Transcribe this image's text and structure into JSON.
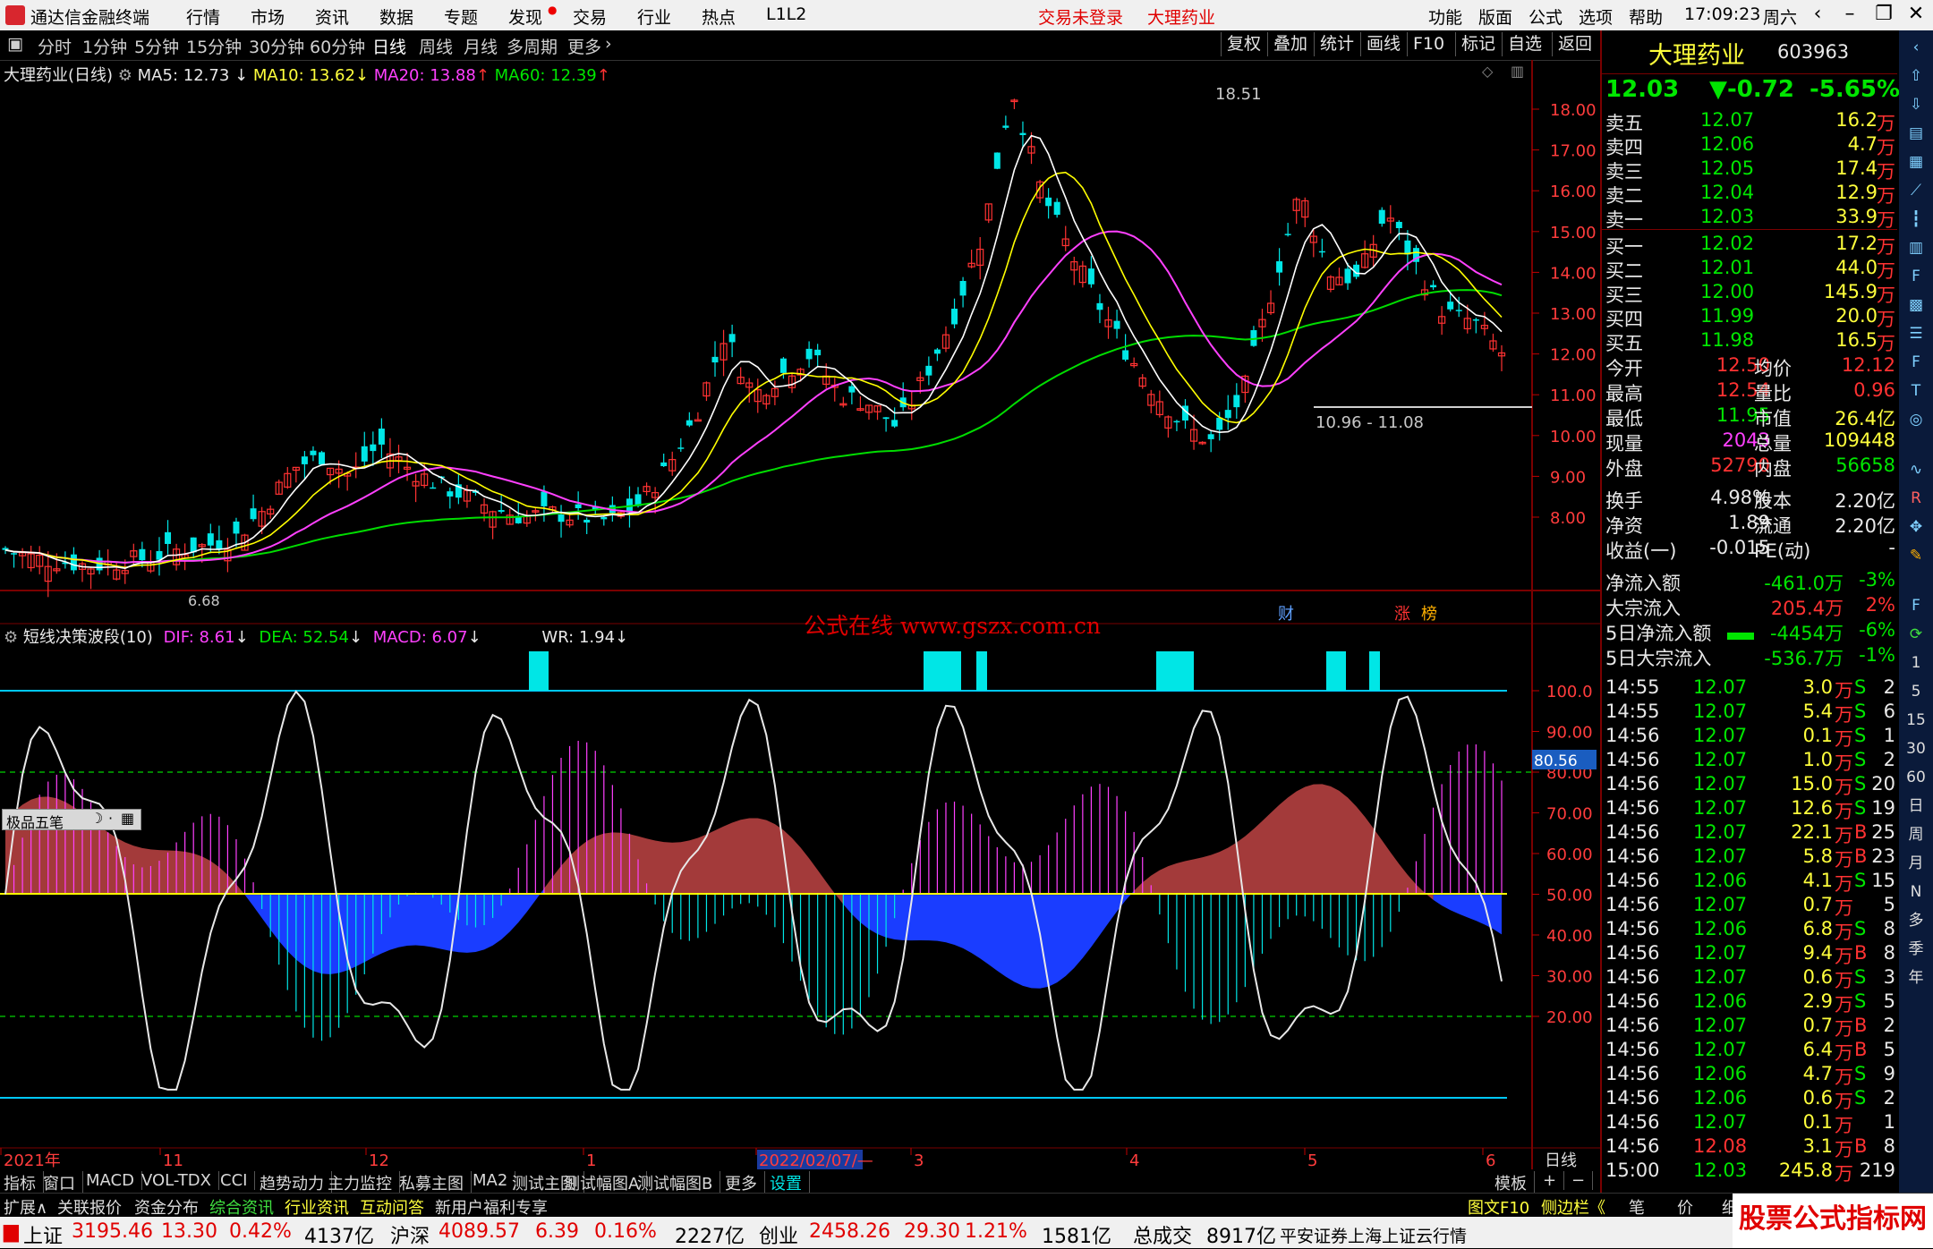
{
  "titlebar": {
    "app_title": "通达信金融终端",
    "menus": [
      "行情",
      "市场",
      "资讯",
      "数据",
      "专题",
      "发现",
      "交易",
      "行业",
      "热点",
      "L1L2"
    ],
    "login_status": "交易未登录",
    "stock_name": "大理药业",
    "right_menus": [
      "功能",
      "版面",
      "公式",
      "选项",
      "帮助"
    ],
    "clock": "17:09:23",
    "weekday": "周六"
  },
  "periodbar": {
    "tabs": [
      "分时",
      "1分钟",
      "5分钟",
      "15分钟",
      "30分钟",
      "60分钟",
      "日线",
      "周线",
      "月线",
      "多周期",
      "更多"
    ],
    "active": "日线",
    "right_buttons": [
      "复权",
      "叠加",
      "统计",
      "画线",
      "F10",
      "标记",
      "自选",
      "返回"
    ]
  },
  "main_legend": {
    "title": "大理药业(日线)",
    "ma5": "MA5: 12.73",
    "ma10": "MA10: 13.62",
    "ma20": "MA20: 13.88",
    "ma60": "MA60: 12.39",
    "high_label": "18.51",
    "low_label": "6.68",
    "range_label": "10.96 - 11.08",
    "markers": [
      "财",
      "涨",
      "榜"
    ],
    "watermark": "公式在线 www.gszx.com.cn",
    "float_tool": "极品五笔"
  },
  "price_axis": [
    "18.00",
    "17.00",
    "16.00",
    "15.00",
    "14.00",
    "13.00",
    "12.00",
    "11.00",
    "10.00",
    "9.00",
    "8.00"
  ],
  "sub_legend": {
    "title": "短线决策波段(10)",
    "dif": "DIF: 8.61",
    "dea": "DEA: 52.54",
    "macd": "MACD: 6.07",
    "wr": "WR: 1.94",
    "current_value": "80.56"
  },
  "sub_axis": [
    "100.0",
    "90.00",
    "80.00",
    "70.00",
    "60.00",
    "50.00",
    "40.00",
    "30.00",
    "20.00"
  ],
  "date_axis": {
    "labels": [
      "2021年",
      "11",
      "12",
      "1",
      "2022/02/07/—",
      "3",
      "4",
      "5",
      "6"
    ],
    "period": "日线"
  },
  "quote": {
    "name": "大理药业",
    "code": "603963",
    "price": "12.03",
    "change": "▼-0.72",
    "pct": "-5.65%",
    "asks": [
      {
        "label": "卖五",
        "price": "12.07",
        "vol": "16.2",
        "unit": "万"
      },
      {
        "label": "卖四",
        "price": "12.06",
        "vol": "4.7",
        "unit": "万"
      },
      {
        "label": "卖三",
        "price": "12.05",
        "vol": "17.4",
        "unit": "万"
      },
      {
        "label": "卖二",
        "price": "12.04",
        "vol": "12.9",
        "unit": "万"
      },
      {
        "label": "卖一",
        "price": "12.03",
        "vol": "33.9",
        "unit": "万"
      }
    ],
    "bids": [
      {
        "label": "买一",
        "price": "12.02",
        "vol": "17.2",
        "unit": "万"
      },
      {
        "label": "买二",
        "price": "12.01",
        "vol": "44.0",
        "unit": "万"
      },
      {
        "label": "买三",
        "price": "12.00",
        "vol": "145.9",
        "unit": "万"
      },
      {
        "label": "买四",
        "price": "11.99",
        "vol": "20.0",
        "unit": "万"
      },
      {
        "label": "买五",
        "price": "11.98",
        "vol": "16.5",
        "unit": "万"
      }
    ],
    "stats": [
      {
        "k1": "今开",
        "v1": "12.50",
        "k2": "均价",
        "v2": "12.12"
      },
      {
        "k1": "最高",
        "v1": "12.54",
        "k2": "量比",
        "v2": "0.96"
      },
      {
        "k1": "最低",
        "v1": "11.95",
        "k2": "市值",
        "v2": "26.4亿"
      },
      {
        "k1": "现量",
        "v1": "2043",
        "k2": "总量",
        "v2": "109448"
      },
      {
        "k1": "外盘",
        "v1": "52790",
        "k2": "内盘",
        "v2": "56658"
      }
    ],
    "fundamentals": [
      {
        "k1": "换手",
        "v1": "4.98%",
        "k2": "股本",
        "v2": "2.20亿"
      },
      {
        "k1": "净资",
        "v1": "1.89",
        "k2": "流通",
        "v2": "2.20亿"
      },
      {
        "k1": "收益(一)",
        "v1": "-0.015",
        "k2": "PE(动)",
        "v2": "-"
      }
    ],
    "flows": [
      {
        "label": "净流入额",
        "value": "-461.0万",
        "pct": "-3%"
      },
      {
        "label": "大宗流入",
        "value": "205.4万",
        "pct": "2%"
      },
      {
        "label": "5日净流入额",
        "value": "-4454万",
        "pct": "-6%"
      },
      {
        "label": "5日大宗流入",
        "value": "-536.7万",
        "pct": "-1%"
      }
    ],
    "ticks": [
      {
        "t": "14:55",
        "p": "12.07",
        "v": "3.0",
        "u": "万",
        "s": "S",
        "n": "2"
      },
      {
        "t": "14:55",
        "p": "12.07",
        "v": "5.4",
        "u": "万",
        "s": "S",
        "n": "6"
      },
      {
        "t": "14:56",
        "p": "12.07",
        "v": "0.1",
        "u": "万",
        "s": "S",
        "n": "1"
      },
      {
        "t": "14:56",
        "p": "12.07",
        "v": "1.0",
        "u": "万",
        "s": "S",
        "n": "2"
      },
      {
        "t": "14:56",
        "p": "12.07",
        "v": "15.0",
        "u": "万",
        "s": "S",
        "n": "20"
      },
      {
        "t": "14:56",
        "p": "12.07",
        "v": "12.6",
        "u": "万",
        "s": "S",
        "n": "19"
      },
      {
        "t": "14:56",
        "p": "12.07",
        "v": "22.1",
        "u": "万",
        "s": "B",
        "n": "25"
      },
      {
        "t": "14:56",
        "p": "12.07",
        "v": "5.8",
        "u": "万",
        "s": "B",
        "n": "23"
      },
      {
        "t": "14:56",
        "p": "12.06",
        "v": "4.1",
        "u": "万",
        "s": "S",
        "n": "15"
      },
      {
        "t": "14:56",
        "p": "12.07",
        "v": "0.7",
        "u": "万",
        "s": "",
        "n": "5"
      },
      {
        "t": "14:56",
        "p": "12.06",
        "v": "6.8",
        "u": "万",
        "s": "S",
        "n": "8"
      },
      {
        "t": "14:56",
        "p": "12.07",
        "v": "9.4",
        "u": "万",
        "s": "B",
        "n": "8"
      },
      {
        "t": "14:56",
        "p": "12.07",
        "v": "0.6",
        "u": "万",
        "s": "S",
        "n": "3"
      },
      {
        "t": "14:56",
        "p": "12.06",
        "v": "2.9",
        "u": "万",
        "s": "S",
        "n": "5"
      },
      {
        "t": "14:56",
        "p": "12.07",
        "v": "0.7",
        "u": "万",
        "s": "B",
        "n": "2"
      },
      {
        "t": "14:56",
        "p": "12.07",
        "v": "6.4",
        "u": "万",
        "s": "B",
        "n": "5"
      },
      {
        "t": "14:56",
        "p": "12.06",
        "v": "4.7",
        "u": "万",
        "s": "S",
        "n": "9"
      },
      {
        "t": "14:56",
        "p": "12.06",
        "v": "0.6",
        "u": "万",
        "s": "S",
        "n": "2"
      },
      {
        "t": "14:56",
        "p": "12.07",
        "v": "0.1",
        "u": "万",
        "s": "",
        "n": "1"
      },
      {
        "t": "14:56",
        "p": "12.08",
        "v": "3.1",
        "u": "万",
        "s": "B",
        "n": "8"
      },
      {
        "t": "15:00",
        "p": "12.03",
        "v": "245.8",
        "u": "万",
        "s": "",
        "n": "219"
      }
    ]
  },
  "indicator_tabs": [
    "指标",
    "窗口",
    "MACD",
    "VOL-TDX",
    "CCI",
    "趋势动力",
    "主力监控",
    "私募主图",
    "MA2",
    "测试主图",
    "测试幅图A",
    "测试幅图B",
    "更多",
    "设置"
  ],
  "template_btn": "模板",
  "info_tabs": [
    "扩展∧",
    "关联报价",
    "资金分布",
    "综合资讯",
    "行业资讯",
    "互动问答",
    "新用户福利专享"
  ],
  "info_right": [
    "图文F10",
    "侧边栏《",
    "笔",
    "价",
    "细"
  ],
  "watermark2": "股票公式指标网",
  "status": {
    "sh_label": "上证",
    "sh_val": "3195.46",
    "sh_chg": "13.30",
    "sh_pct": "0.42%",
    "sh_amt": "4137亿",
    "hs_label": "沪深",
    "hs_val": "4089.57",
    "hs_chg": "6.39",
    "hs_pct": "0.16%",
    "hs_amt": "2227亿",
    "cy_label": "创业",
    "cy_val": "2458.26",
    "cy_chg": "29.30",
    "cy_pct": "1.21%",
    "cy_amt": "1581亿",
    "total_label": "总成交",
    "total_val": "8917亿",
    "server": "平安证券上海上证云行情"
  },
  "colors": {
    "up": "#ff3232",
    "down": "#00e6e6",
    "ma5": "#ffffff",
    "ma10": "#ffff00",
    "ma20": "#ff40ff",
    "ma60": "#00dd00",
    "band_up": "#a33a3a",
    "band_down": "#1a3dff"
  },
  "chart_data": {
    "type": "line",
    "title": "大理药业(日线)",
    "ylim": [
      6.5,
      19
    ],
    "approx_close": [
      7.2,
      7.0,
      6.9,
      6.8,
      6.9,
      7.0,
      7.2,
      7.3,
      7.5,
      8.2,
      9.2,
      9.5,
      9.0,
      9.8,
      9.2,
      8.8,
      8.5,
      8.2,
      8.0,
      8.1,
      8.0,
      7.9,
      8.3,
      9.2,
      10.5,
      12.5,
      11.0,
      11.5,
      12.0,
      11.0,
      10.8,
      10.2,
      11.5,
      13.0,
      15.0,
      18.5,
      16.0,
      14.5,
      13.2,
      12.0,
      11.0,
      10.2,
      9.8,
      11.0,
      13.5,
      16.0,
      14.0,
      13.8,
      15.5,
      14.2,
      13.0,
      12.8,
      12.03
    ]
  }
}
